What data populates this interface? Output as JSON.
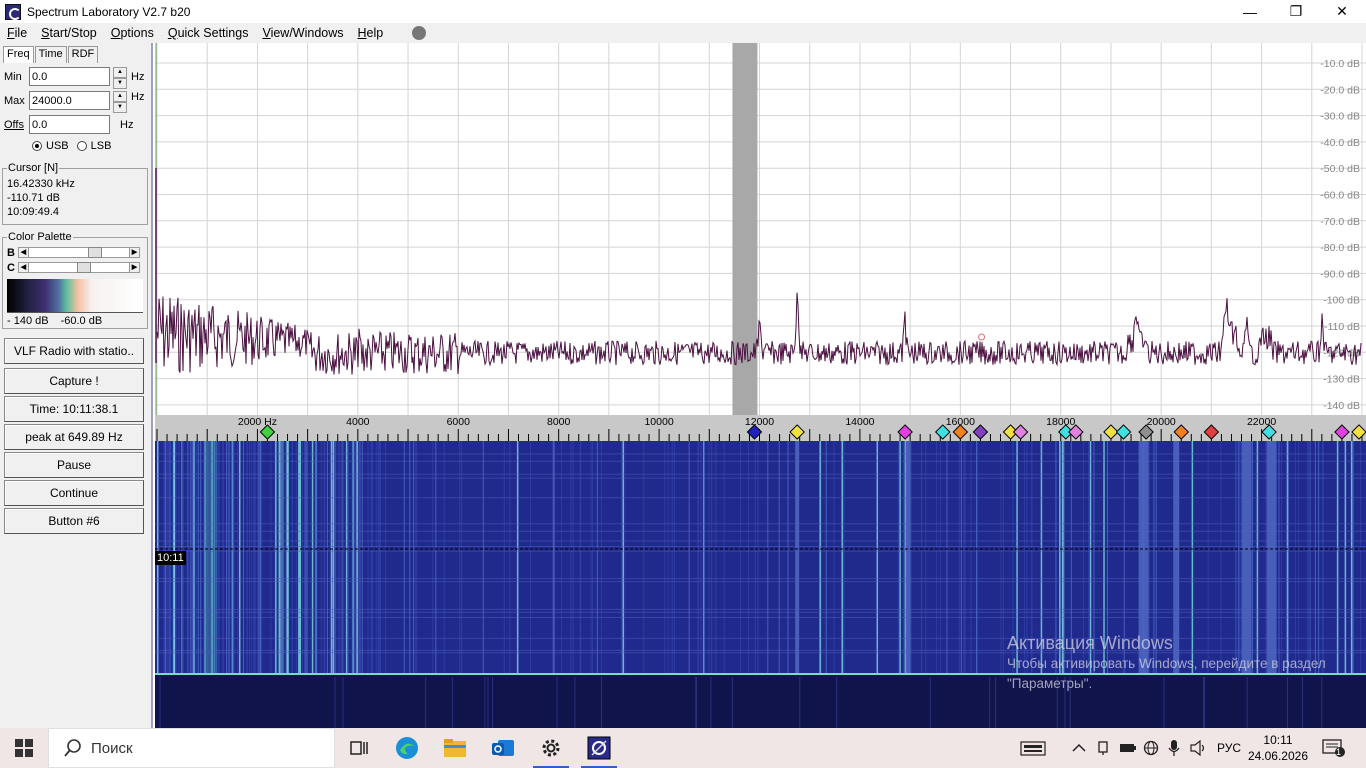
{
  "window": {
    "title": "Spectrum Laboratory V2.7 b20",
    "minimize": "—",
    "maximize": "❐",
    "close": "✕"
  },
  "menu": [
    "File",
    "Start/Stop",
    "Options",
    "Quick Settings",
    "View/Windows",
    "Help"
  ],
  "tabs": [
    "Freq",
    "Time",
    "RDF"
  ],
  "freq": {
    "min_label": "Min",
    "min_value": "0.0",
    "min_unit": "Hz",
    "max_label": "Max",
    "max_value": "24000.0",
    "max_unit": "Hz",
    "offs_label": "Offs",
    "offs_value": "0.0",
    "offs_unit": "Hz",
    "usb": "USB",
    "lsb": "LSB",
    "sideband_selected": "USB"
  },
  "cursor": {
    "title": "Cursor [N]",
    "freq": "16.42330 kHz",
    "level": "-110.71 dB",
    "time": "10:09:49.4"
  },
  "palette": {
    "title": "Color Palette",
    "b_label": "B",
    "c_label": "C",
    "min_label": "- 140 dB",
    "max_label": "-60.0 dB",
    "b_value": 0.62,
    "c_value": 0.5
  },
  "buttons": [
    "VLF Radio with statio..",
    "Capture !",
    "Time:  10:11:38.1",
    "peak at 649.89 Hz",
    "Pause",
    "Continue",
    "Button #6"
  ],
  "spectrum": {
    "db_labels": [
      "-10.0 dB",
      "-20.0 dB",
      "-30.0 dB",
      "-40.0 dB",
      "-50.0 dB",
      "-60.0 dB",
      "-70.0 dB",
      "-80.0 dB",
      "-90.0 dB",
      "-100 dB",
      "-110 dB",
      "-120 dB",
      "-130 dB",
      "-140 dB"
    ],
    "line_color": "#4a1040",
    "freq_max": 24000,
    "highlight_band_hz": [
      11700,
      12200
    ]
  },
  "scale": {
    "labels": [
      {
        "hz": 2000,
        "text": "2000 Hz"
      },
      {
        "hz": 4000,
        "text": "4000"
      },
      {
        "hz": 6000,
        "text": "6000"
      },
      {
        "hz": 8000,
        "text": "8000"
      },
      {
        "hz": 10000,
        "text": "10000"
      },
      {
        "hz": 12000,
        "text": "12000"
      },
      {
        "hz": 14000,
        "text": "14000"
      },
      {
        "hz": 16000,
        "text": "16000"
      },
      {
        "hz": 18000,
        "text": "18000"
      },
      {
        "hz": 20000,
        "text": "20000"
      },
      {
        "hz": 22000,
        "text": "22000"
      }
    ],
    "markers": [
      {
        "hz": 2200,
        "color": "#40d040"
      },
      {
        "hz": 11900,
        "color": "#2020c0"
      },
      {
        "hz": 12750,
        "color": "#f0e040"
      },
      {
        "hz": 14900,
        "color": "#e040e0"
      },
      {
        "hz": 15650,
        "color": "#40e0e0"
      },
      {
        "hz": 16000,
        "color": "#f08020"
      },
      {
        "hz": 16400,
        "color": "#8040c0"
      },
      {
        "hz": 17000,
        "color": "#f0e040"
      },
      {
        "hz": 17200,
        "color": "#e080e0"
      },
      {
        "hz": 18100,
        "color": "#40e0e0"
      },
      {
        "hz": 18300,
        "color": "#e080e0"
      },
      {
        "hz": 19000,
        "color": "#f0e040"
      },
      {
        "hz": 19250,
        "color": "#40e0e0"
      },
      {
        "hz": 19700,
        "color": "#909090"
      },
      {
        "hz": 20400,
        "color": "#f08020"
      },
      {
        "hz": 21000,
        "color": "#e04040"
      },
      {
        "hz": 22150,
        "color": "#40e0e0"
      },
      {
        "hz": 23600,
        "color": "#e040e0"
      },
      {
        "hz": 24000,
        "color": "#f0e040"
      }
    ]
  },
  "waterfall": {
    "time_label": "10:11"
  },
  "activation": {
    "title": "Активация Windows",
    "line": "Чтобы активировать Windows, перейдите в раздел \"Параметры\"."
  },
  "taskbar": {
    "search_placeholder": "Поиск",
    "lang": "РУС",
    "time": "10:11",
    "date": "24.06.2026",
    "notifications": "1"
  }
}
